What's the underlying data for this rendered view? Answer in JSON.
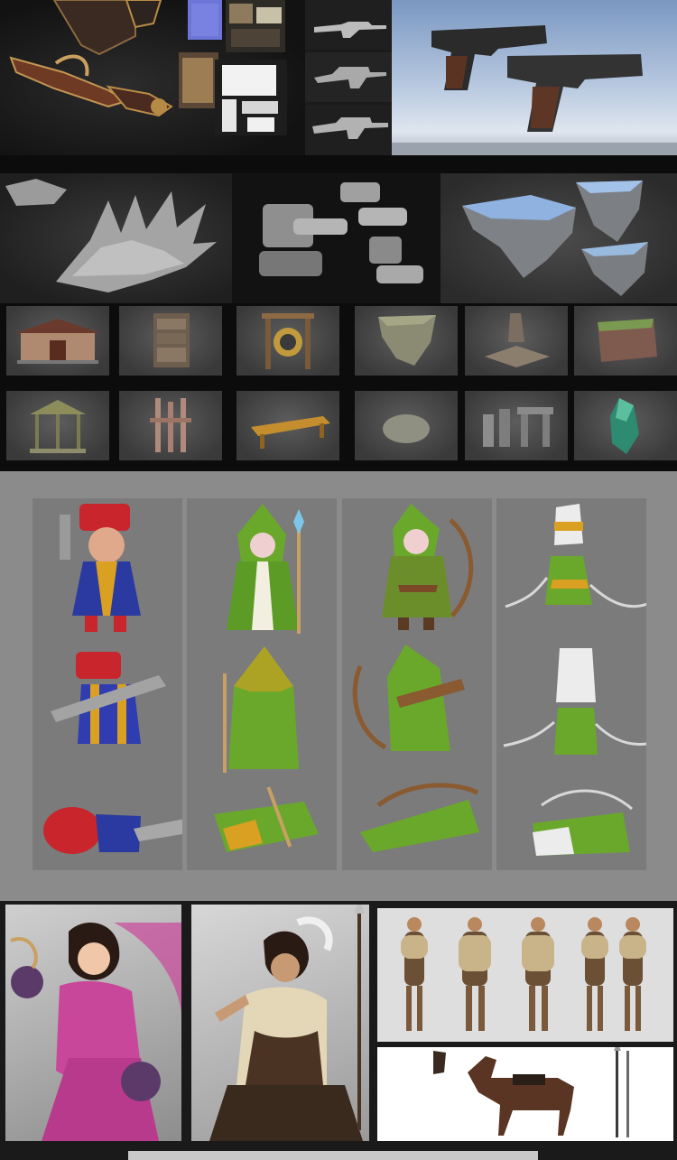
{
  "page": {
    "background": "#ffffff",
    "sections": [
      {
        "id": "hard-surface-props",
        "background": "#111111"
      },
      {
        "id": "environment-assets",
        "background": "#0c0c0c"
      },
      {
        "id": "stylized-characters",
        "background": "#8b8b8b"
      },
      {
        "id": "character-illustrations",
        "background": "#1a1a1a"
      }
    ]
  },
  "colors": {
    "sky_blue": "#7a97c2",
    "character_green": "#6aa82b",
    "gold_trim": "#d9a021",
    "red_cloth": "#c8262c",
    "ice_blue": "#7ea7d8",
    "pink_robe": "#c9479a"
  }
}
